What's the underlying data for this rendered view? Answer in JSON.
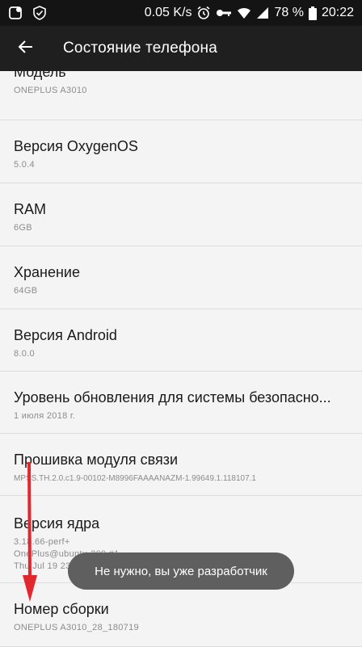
{
  "status_bar": {
    "speed": "0.05 K/s",
    "battery": "78 %",
    "time": "20:22",
    "icons": [
      "notification-icon",
      "shield-icon",
      "alarm-icon",
      "key-icon",
      "wifi-icon",
      "signal-icon",
      "battery-icon"
    ]
  },
  "app_bar": {
    "back_icon": "arrow-back-icon",
    "title": "Состояние телефона"
  },
  "items": [
    {
      "title": "Модель",
      "sub": "ONEPLUS A3010"
    },
    {
      "title": "Версия OxygenOS",
      "sub": "5.0.4"
    },
    {
      "title": "RAM",
      "sub": "6GB"
    },
    {
      "title": "Хранение",
      "sub": "64GB"
    },
    {
      "title": "Версия Android",
      "sub": "8.0.0"
    },
    {
      "title": "Уровень обновления для системы безопасно...",
      "sub": "1 июля 2018 г."
    },
    {
      "title": "Прошивка модуля связи",
      "sub": "MPSS.TH.2.0.c1.9-00102-M8996FAAAANAZM-1.99649.1.118107.1"
    },
    {
      "title": "Версия ядра",
      "sub": "3.18.66-perf+\nOnePlus@ubuntu-209 #1\nThu Jul 19 23:30:23 CST 2018"
    },
    {
      "title": "Номер сборки",
      "sub": "ONEPLUS A3010_28_180719"
    }
  ],
  "toast": {
    "text": "Не нужно, вы уже разработчик"
  },
  "annotation": {
    "color": "#e0282e"
  },
  "colors": {
    "status_bar": "#141414",
    "app_bar": "#1f1f1f",
    "background": "#f4f4f4",
    "toast": "#5f5f5f"
  }
}
